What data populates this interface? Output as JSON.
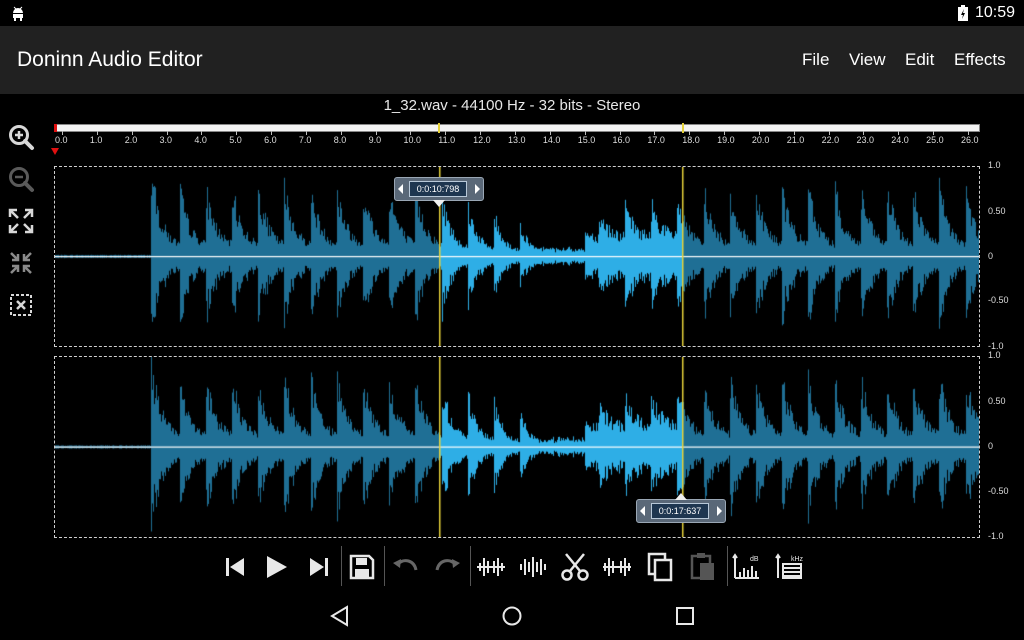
{
  "status_bar": {
    "time": "10:59",
    "icons": [
      "android-icon",
      "battery-icon"
    ]
  },
  "app_bar": {
    "title": "Doninn Audio Editor",
    "menu": [
      "File",
      "View",
      "Edit",
      "Effects"
    ]
  },
  "file_info": "1_32.wav - 44100 Hz - 32 bits - Stereo",
  "ruler": {
    "ticks": [
      "0.0",
      "1.0",
      "2.0",
      "3.0",
      "4.0",
      "5.0",
      "6.0",
      "7.0",
      "8.0",
      "9.0",
      "10.0",
      "11.0",
      "12.0",
      "13.0",
      "14.0",
      "15.0",
      "16.0",
      "17.0",
      "18.0",
      "19.0",
      "20.0",
      "21.0",
      "22.0",
      "23.0",
      "24.0",
      "25.0",
      "26.0"
    ]
  },
  "amplitude_labels": [
    "1.0",
    "0.50",
    "0",
    "-0.50",
    "-1.0"
  ],
  "selection": {
    "start_label": "0:0:10:798",
    "end_label": "0:0:17:637",
    "start_seconds": 10.798,
    "end_seconds": 17.637,
    "total_seconds": 26.0
  },
  "channels": [
    "left",
    "right"
  ],
  "colors": {
    "waveform": "#1f6f95",
    "waveform_selected": "#2eaee6",
    "selection_line": "#e6d23a",
    "app_bar": "#212121",
    "background": "#000000"
  },
  "left_tools": [
    "zoom-in-icon",
    "zoom-out-icon",
    "expand-icon",
    "collapse-icon",
    "clear-selection-icon"
  ],
  "toolbar": [
    "skip-to-start-icon",
    "play-icon",
    "skip-to-end-icon",
    "save-icon",
    "undo-icon",
    "redo-icon",
    "silence-icon",
    "trim-icon",
    "cut-icon",
    "delete-icon",
    "copy-icon",
    "paste-icon",
    "amplify-icon",
    "resample-icon"
  ],
  "nav_bar": [
    "back-icon",
    "home-icon",
    "recents-icon"
  ]
}
